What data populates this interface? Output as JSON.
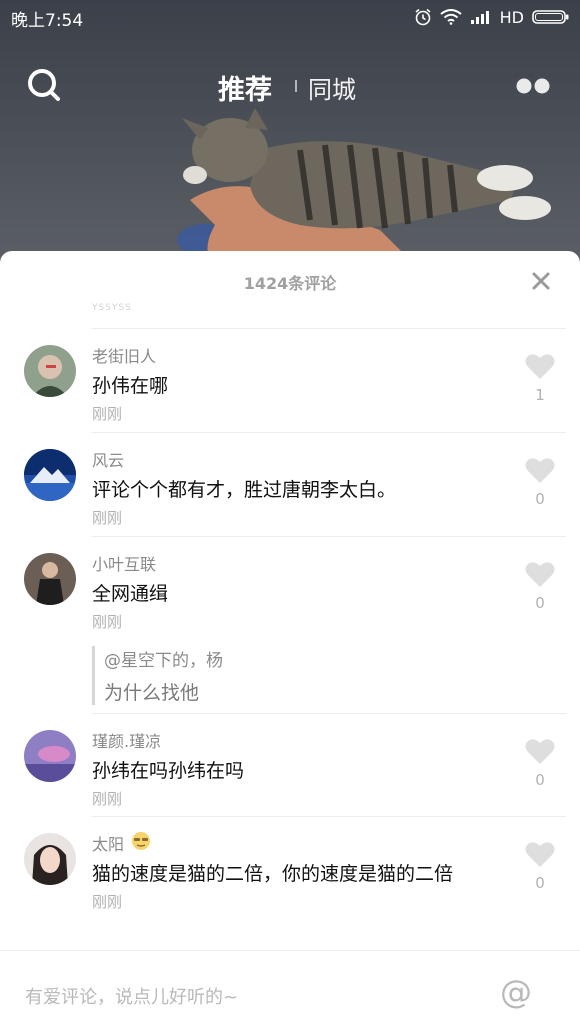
{
  "status_bar": {
    "time": "晚上7:54",
    "network": "HD"
  },
  "nav": {
    "tab_recommend": "推荐",
    "tab_city": "同城"
  },
  "sheet": {
    "title": "1424条评论",
    "prev_remnant": "YSSYSS"
  },
  "comments": [
    {
      "user": "老街旧人",
      "text": "孙伟在哪",
      "time": "刚刚",
      "likes": "1"
    },
    {
      "user": "风云",
      "text": "评论个个都有才，胜过唐朝李太白。",
      "time": "刚刚",
      "likes": "0"
    },
    {
      "user": "小叶互联",
      "text": "全网通缉",
      "time": "刚刚",
      "likes": "0",
      "reply": {
        "user": "@星空下的，杨",
        "text": "为什么找他"
      }
    },
    {
      "user": "瑾颜.瑾凉",
      "text": "孙纬在吗孙纬在吗",
      "time": "刚刚",
      "likes": "0"
    },
    {
      "user": "太阳",
      "text": "猫的速度是猫的二倍，你的速度是猫的二倍",
      "time": "刚刚",
      "likes": "0"
    }
  ],
  "input": {
    "placeholder": "有爱评论，说点儿好听的~",
    "at_symbol": "@"
  },
  "colors": {
    "sheet_bg": "#ffffff",
    "secondary_text": "#8a8a8a",
    "muted_text": "#b2b2b2",
    "heart": "#dedede"
  }
}
